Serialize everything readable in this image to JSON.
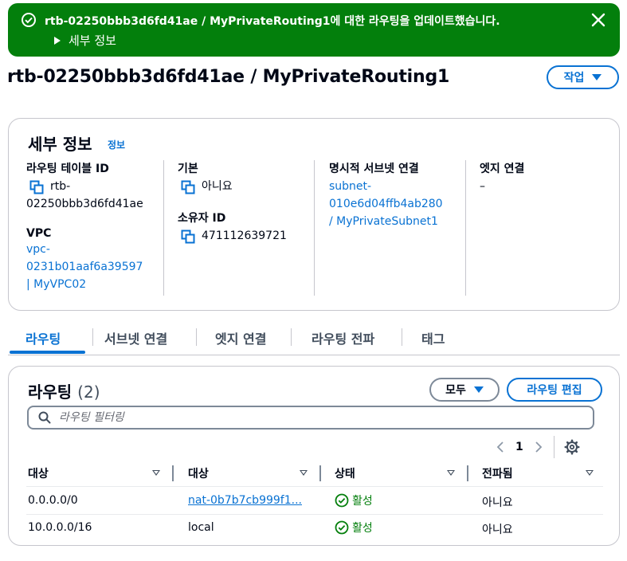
{
  "flash": {
    "message": "rtb-02250bbb3d6fd41ae / MyPrivateRouting1에 대한 라우팅을 업데이트했습니다.",
    "details_label": "세부 정보",
    "type_color": "#037f0c"
  },
  "page": {
    "title": "rtb-02250bbb3d6fd41ae / MyPrivateRouting1",
    "actions_label": "작업"
  },
  "details": {
    "title": "세부 정보",
    "info": "정보",
    "route_table_id_label": "라우팅 테이블 ID",
    "route_table_id": "rtb-02250bbb3d6fd41ae",
    "route_table_id_line1": "rtb-",
    "route_table_id_line2": "02250bbb3d6fd41ae",
    "vpc_label": "VPC",
    "vpc_line1": "vpc-",
    "vpc_line2": "0231b01aaf6a39597",
    "vpc_line3": "| MyVPC02",
    "main_label": "기본",
    "main_value": "아니요",
    "owner_label": "소유자 ID",
    "owner_value": "471112639721",
    "subnet_assoc_label": "명시적 서브넷 연결",
    "subnet_line1": "subnet-",
    "subnet_line2": "010e6d04ffb4ab280",
    "subnet_line3": "/ MyPrivateSubnet1",
    "edge_label": "엣지 연결",
    "edge_value": "–"
  },
  "tabs": [
    {
      "label": "라우팅",
      "active": true
    },
    {
      "label": "서브넷 연결",
      "active": false
    },
    {
      "label": "엣지 연결",
      "active": false
    },
    {
      "label": "라우팅 전파",
      "active": false
    },
    {
      "label": "태그",
      "active": false
    }
  ],
  "routes": {
    "title": "라우팅",
    "count": "(2)",
    "filter_label": "모두",
    "edit_label": "라우팅 편집",
    "search_placeholder": "라우팅 필터링",
    "page_number": "1",
    "columns": [
      "대상",
      "대상",
      "상태",
      "전파됨"
    ],
    "rows": [
      {
        "destination": "0.0.0.0/0",
        "target": "nat-0b7b7cb999f1...",
        "status": "활성",
        "propagated": "아니요"
      },
      {
        "destination": "10.0.0.0/16",
        "target": "local",
        "status": "활성",
        "propagated": "아니요"
      }
    ]
  },
  "colors": {
    "accent": "#0972d3",
    "success": "#037f0c",
    "border": "#c6c6cd"
  }
}
